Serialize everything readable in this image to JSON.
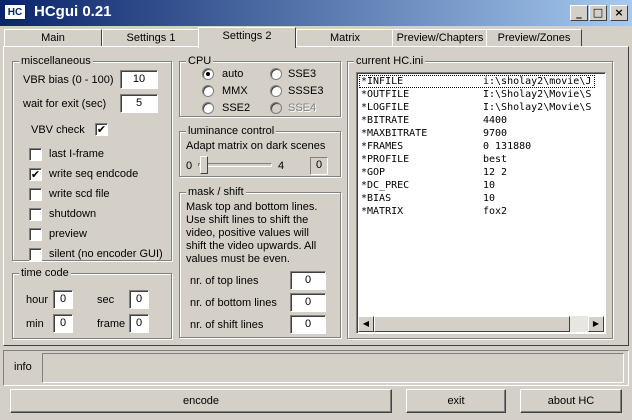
{
  "window": {
    "icon_text": "HC",
    "title": "HCgui 0.21",
    "controls": {
      "minimize": "_",
      "maximize": "□",
      "close": "×"
    }
  },
  "tabs": [
    "Main",
    "Settings 1",
    "Settings 2",
    "Matrix",
    "Preview/Chapters",
    "Preview/Zones"
  ],
  "active_tab": "Settings 2",
  "misc": {
    "title": "miscellaneous",
    "vbr_bias_label": "VBR bias (0 - 100)",
    "vbr_bias_value": "10",
    "wait_exit_label": "wait for exit (sec)",
    "wait_exit_value": "5",
    "vbv_label": "VBV check",
    "vbv_checked": true,
    "checks": [
      {
        "label": "last I-frame",
        "checked": false
      },
      {
        "label": "write seq endcode",
        "checked": true
      },
      {
        "label": "write scd file",
        "checked": false
      },
      {
        "label": "shutdown",
        "checked": false
      },
      {
        "label": "preview",
        "checked": false
      },
      {
        "label": "silent (no encoder GUI)",
        "checked": false
      }
    ]
  },
  "timecode": {
    "title": "time code",
    "hour_label": "hour",
    "hour_value": "0",
    "sec_label": "sec",
    "sec_value": "0",
    "min_label": "min",
    "min_value": "0",
    "frame_label": "frame",
    "frame_value": "0"
  },
  "cpu": {
    "title": "CPU",
    "options": [
      {
        "label": "auto",
        "selected": true,
        "disabled": false
      },
      {
        "label": "SSE3",
        "selected": false,
        "disabled": false
      },
      {
        "label": "MMX",
        "selected": false,
        "disabled": false
      },
      {
        "label": "SSSE3",
        "selected": false,
        "disabled": false
      },
      {
        "label": "SSE2",
        "selected": false,
        "disabled": false
      },
      {
        "label": "SSE4",
        "selected": false,
        "disabled": true
      }
    ]
  },
  "luminance": {
    "title": "luminance control",
    "description": "Adapt matrix on dark scenes",
    "min_label": "0",
    "max_label": "4",
    "current_value": "0",
    "slider_fraction": 0.0
  },
  "mask": {
    "title": "mask / shift",
    "description": "Mask top and bottom lines. Use shift lines to shift the video, positive values will shift the video upwards. All values must be even.",
    "top_label": "nr. of top lines",
    "top_value": "0",
    "bottom_label": "nr. of bottom lines",
    "bottom_value": "0",
    "shift_label": "nr. of shift lines",
    "shift_value": "0"
  },
  "ini": {
    "title": "current HC.ini",
    "rows": [
      {
        "key": "*INFILE",
        "value": "i:\\sholay2\\movie\\J"
      },
      {
        "key": "*OUTFILE",
        "value": "I:\\Sholay2\\Movie\\S"
      },
      {
        "key": "*LOGFILE",
        "value": "I:\\Sholay2\\Movie\\S"
      },
      {
        "key": "*BITRATE",
        "value": "4400"
      },
      {
        "key": "*MAXBITRATE",
        "value": "9700"
      },
      {
        "key": "*FRAMES",
        "value": "0 131880"
      },
      {
        "key": "*PROFILE",
        "value": "best"
      },
      {
        "key": "*GOP",
        "value": "12 2"
      },
      {
        "key": "*DC_PREC",
        "value": "10"
      },
      {
        "key": "*BIAS",
        "value": "10"
      },
      {
        "key": "*MATRIX",
        "value": "fox2"
      }
    ]
  },
  "info": {
    "label": "info",
    "text": ""
  },
  "buttons": {
    "encode": "encode",
    "exit": "exit",
    "about": "about HC"
  },
  "scroll_glyphs": {
    "left": "◀",
    "right": "▶"
  },
  "check_glyph": "✔"
}
